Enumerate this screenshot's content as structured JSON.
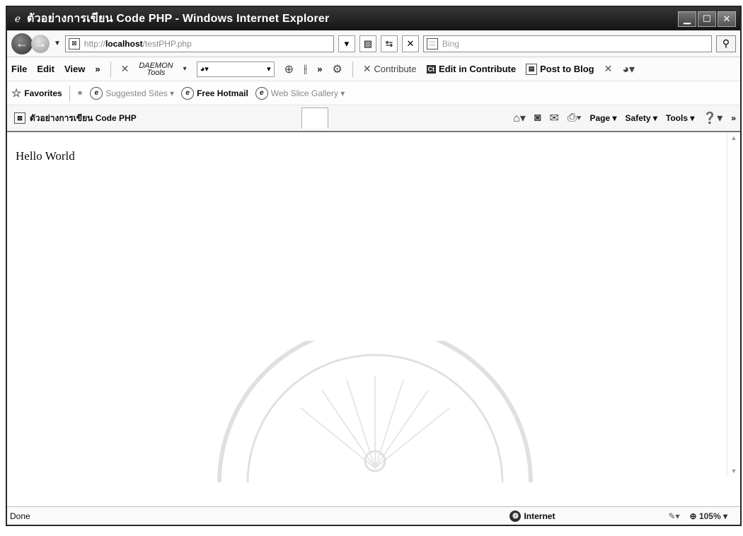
{
  "window": {
    "title": "ตัวอย่างการเขียน Code PHP - Windows Internet Explorer"
  },
  "address": {
    "url_protocol": "http://",
    "url_host": "localhost",
    "url_path": "/testPHP.php",
    "search_placeholder": "Bing"
  },
  "menu": {
    "items": [
      "File",
      "Edit",
      "View"
    ],
    "overflow": "»",
    "daemon_top": "DAEMON",
    "daemon_bottom": "Tools",
    "contribute": "Contribute",
    "edit_in_contribute": "Edit in Contribute",
    "post_to_blog": "Post to Blog"
  },
  "favorites": {
    "label": "Favorites",
    "suggested_sites": "Suggested Sites ▾",
    "free_hotmail": "Free Hotmail",
    "web_slice_gallery": "Web Slice Gallery ▾"
  },
  "tab": {
    "title": "ตัวอย่างการเขียน Code PHP"
  },
  "commandbar": {
    "page": "Page ▾",
    "safety": "Safety ▾",
    "tools": "Tools ▾"
  },
  "content": {
    "text": "Hello World"
  },
  "status": {
    "text": "Done",
    "zone": "Internet",
    "zoom": "105%"
  },
  "icons": {
    "back": "back-arrow-icon",
    "forward": "forward-arrow-icon",
    "refresh": "refresh-icon",
    "stop": "stop-icon",
    "search": "search-icon",
    "home": "home-icon",
    "feeds": "rss-icon",
    "mail": "mail-icon",
    "print": "print-icon",
    "help": "help-icon",
    "globe": "globe-icon"
  }
}
